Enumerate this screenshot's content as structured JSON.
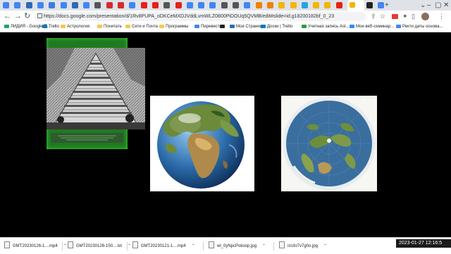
{
  "tabs": [
    {
      "icon": "google-icon",
      "color": "#4285f4"
    },
    {
      "icon": "google-icon",
      "color": "#4285f4"
    },
    {
      "icon": "vk-icon",
      "color": "#2d6bb3"
    },
    {
      "icon": "google-icon",
      "color": "#4285f4"
    },
    {
      "icon": "number-tab-icon",
      "color": "#3b7ddd"
    },
    {
      "icon": "google-icon",
      "color": "#4285f4"
    },
    {
      "icon": "vk-icon",
      "color": "#2d6bb3"
    },
    {
      "icon": "google-icon",
      "color": "#4285f4"
    },
    {
      "icon": "zen-icon",
      "color": "#555555"
    },
    {
      "icon": "yandex-icon",
      "color": "#d42b2b"
    },
    {
      "icon": "yandex-icon",
      "color": "#d42b2b"
    },
    {
      "icon": "google-icon",
      "color": "#4285f4"
    },
    {
      "icon": "youtube-icon",
      "color": "#e62117"
    },
    {
      "icon": "youtube-icon",
      "color": "#e62117"
    },
    {
      "icon": "zen-icon",
      "color": "#555555"
    },
    {
      "icon": "youtube-icon",
      "color": "#e62117"
    },
    {
      "icon": "google-icon",
      "color": "#4285f4"
    },
    {
      "icon": "star-icon",
      "color": "#4285f4"
    },
    {
      "icon": "google-icon",
      "color": "#4285f4"
    },
    {
      "icon": "zen-icon",
      "color": "#555555"
    },
    {
      "icon": "zen-icon",
      "color": "#555555"
    },
    {
      "icon": "google-icon",
      "color": "#4285f4"
    },
    {
      "icon": "ok-icon",
      "color": "#ee8208"
    },
    {
      "icon": "ok-icon",
      "color": "#ee8208"
    },
    {
      "icon": "slides-icon",
      "color": "#f4b400"
    },
    {
      "icon": "slides-icon",
      "color": "#f4b400"
    },
    {
      "icon": "telegram-icon",
      "color": "#2aa3df"
    },
    {
      "icon": "slides-icon",
      "color": "#f4b400"
    },
    {
      "icon": "slides-icon",
      "color": "#f4b400"
    },
    {
      "icon": "youtube-icon",
      "color": "#e62117"
    },
    {
      "icon": "slides-icon",
      "color": "#f4b400",
      "active": true
    },
    {
      "icon": "github-icon",
      "color": "#222222"
    },
    {
      "icon": "google-icon",
      "color": "#4285f4"
    }
  ],
  "url": "https://docs.google.com/presentation/d/1Rv8PUPA_oDKCeMXDJVddLvmWLZ0800PiDOUq5QVMB/edit#slide=id.g18200182bf_0_23",
  "bookmarks": [
    {
      "label": "ЛИДИЯ - Google П...",
      "icon": "google-drive-icon",
      "color": "#1fa463"
    },
    {
      "label": "Trello",
      "icon": "trello-icon",
      "color": "#0079bf"
    },
    {
      "label": "Астрология",
      "icon": "folder-icon",
      "color": "#f2c94c"
    },
    {
      "label": "Почитать",
      "icon": "folder-icon",
      "color": "#f2c94c"
    },
    {
      "label": "Сети и Почта",
      "icon": "folder-icon",
      "color": "#f2c94c"
    },
    {
      "label": "Программы",
      "icon": "folder-icon",
      "color": "#f2c94c"
    },
    {
      "label": "Перевести",
      "icon": "translate-icon",
      "color": "#4285f4"
    },
    {
      "label": "",
      "icon": "github-icon",
      "color": "#222222"
    },
    {
      "label": "Моя Страница",
      "icon": "vk-icon",
      "color": "#2d6bb3"
    },
    {
      "label": "Доски | Trello",
      "icon": "trello-icon",
      "color": "#0079bf"
    },
    {
      "label": "Учетная запись Ast...",
      "icon": "leaf-icon",
      "color": "#2e9a44"
    },
    {
      "label": "Мои веб-семинар...",
      "icon": "zoom-icon",
      "color": "#2d8cff"
    },
    {
      "label": "Ректи даты основа...",
      "icon": "bookmark-icon",
      "color": "#4285f4"
    }
  ],
  "downloads": [
    {
      "name": "GMT20230126-1....mp4"
    },
    {
      "name": "GMT20230126-150....txt"
    },
    {
      "name": "GMT20230121-1....mp4"
    },
    {
      "name": "wl_0yNpcPokoop.jpg"
    },
    {
      "name": "isUIo7v7g0o.jpg"
    }
  ],
  "clock": "2023-01-27  12:16:5",
  "colors": {
    "accent": "#1a73e8",
    "frame_green": "#1f7a1f",
    "ocean": "#2b6aa8"
  }
}
